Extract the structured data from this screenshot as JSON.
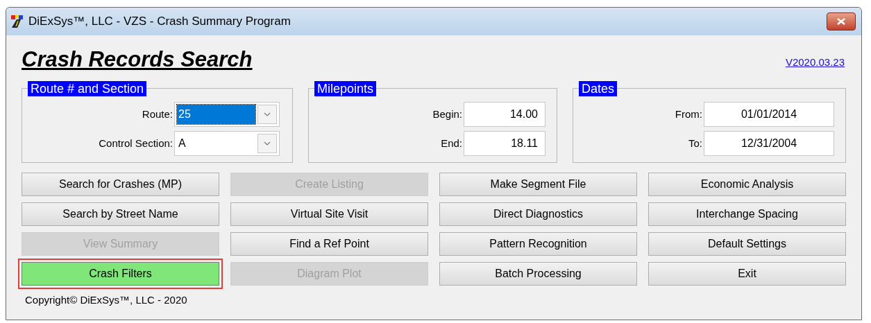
{
  "window": {
    "title": "DiExSys™, LLC - VZS - Crash Summary Program"
  },
  "heading": "Crash Records Search",
  "version_link": "V2020.03.23",
  "groups": [
    {
      "legend": "Route # and Section",
      "fields": [
        {
          "kind": "combo",
          "label": "Route:",
          "value": "25",
          "selected": true
        },
        {
          "kind": "combo",
          "label": "Control Section:",
          "value": "A",
          "selected": false
        }
      ]
    },
    {
      "legend": "Milepoints",
      "fields": [
        {
          "kind": "number",
          "label": "Begin:",
          "value": "14.00"
        },
        {
          "kind": "number",
          "label": "End:",
          "value": "18.11"
        }
      ]
    },
    {
      "legend": "Dates",
      "fields": [
        {
          "kind": "date",
          "label": "From:",
          "value": "01/01/2014"
        },
        {
          "kind": "date",
          "label": "To:",
          "value": "12/31/2004"
        }
      ]
    }
  ],
  "buttons": [
    {
      "label": "Search for Crashes (MP)",
      "disabled": false,
      "highlighted": false
    },
    {
      "label": "Create Listing",
      "disabled": true,
      "highlighted": false
    },
    {
      "label": "Make Segment File",
      "disabled": false,
      "highlighted": false
    },
    {
      "label": "Economic Analysis",
      "disabled": false,
      "highlighted": false
    },
    {
      "label": "Search by Street Name",
      "disabled": false,
      "highlighted": false
    },
    {
      "label": "Virtual Site Visit",
      "disabled": false,
      "highlighted": false
    },
    {
      "label": "Direct Diagnostics",
      "disabled": false,
      "highlighted": false
    },
    {
      "label": "Interchange Spacing",
      "disabled": false,
      "highlighted": false
    },
    {
      "label": "View Summary",
      "disabled": true,
      "highlighted": false
    },
    {
      "label": "Find a Ref Point",
      "disabled": false,
      "highlighted": false
    },
    {
      "label": "Pattern Recognition",
      "disabled": false,
      "highlighted": false
    },
    {
      "label": "Default Settings",
      "disabled": false,
      "highlighted": false
    },
    {
      "label": "Crash Filters",
      "disabled": false,
      "highlighted": true
    },
    {
      "label": "Diagram Plot",
      "disabled": true,
      "highlighted": false
    },
    {
      "label": "Batch Processing",
      "disabled": false,
      "highlighted": false
    },
    {
      "label": "Exit",
      "disabled": false,
      "highlighted": false
    }
  ],
  "copyright": "Copyright© DiExSys™, LLC - 2020"
}
